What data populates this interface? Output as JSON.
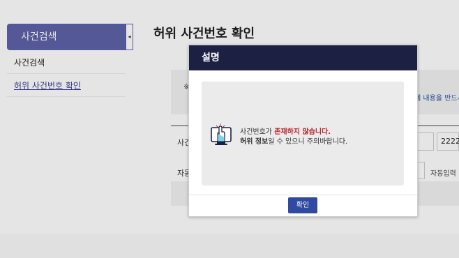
{
  "sidebar": {
    "header": "사건검색",
    "collapse_glyph": "◂",
    "items": [
      {
        "label": "사건검색"
      },
      {
        "label": "허위 사건번호 확인"
      }
    ]
  },
  "main": {
    "title": "허위 사건번호 확인",
    "note_mark": "※",
    "link_fragment": "폐 내용을 반드시",
    "row_label_case": "사건",
    "row_label_auto": "자동",
    "year_value": "2222",
    "auto_input_label": "자동입력 !"
  },
  "modal": {
    "title": "설명",
    "message_part1": "사건번호가 ",
    "message_emphasis": "존재하지 않습니다.",
    "message_bold2": "허위 정보",
    "message_part2": "일 수 있으니 주의바랍니다.",
    "confirm_label": "확인",
    "icon": "pointer-hand-icon"
  },
  "colors": {
    "sidebar_header": "#5e63a8",
    "modal_header": "#1c2144",
    "accent_red": "#b3262c",
    "confirm_button": "#2f4aa0"
  }
}
